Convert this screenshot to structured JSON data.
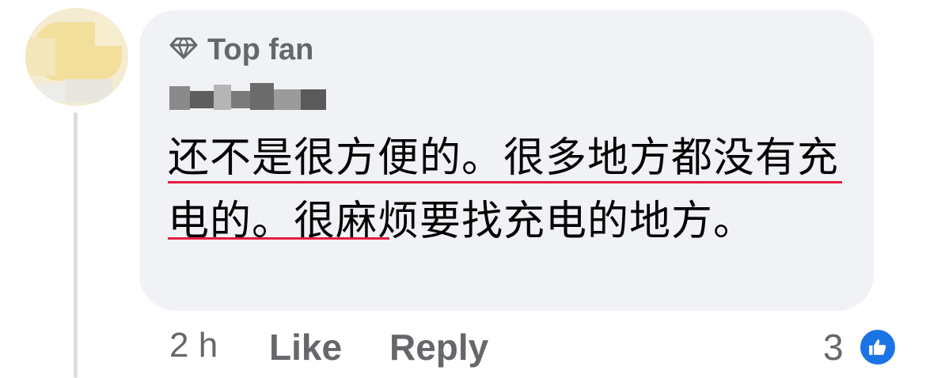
{
  "comment": {
    "badge": "Top fan",
    "text": "还不是很方便的。很多地方都没有充电的。很麻烦要找充电的地方。",
    "time": "2 h",
    "like_label": "Like",
    "reply_label": "Reply",
    "reaction_count": "3",
    "reaction_icon": "thumbs-up-icon"
  },
  "colors": {
    "bubble": "#f0f2f5",
    "secondary_text": "#65676b",
    "primary_text": "#050505",
    "like_blue": "#1b74e4",
    "spellcheck_underline": "#e41e3f"
  }
}
